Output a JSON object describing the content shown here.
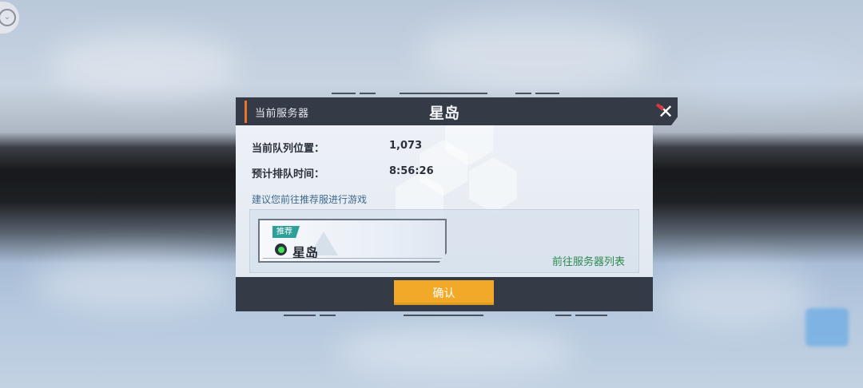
{
  "dialog": {
    "header_label": "当前服务器",
    "title": "星岛",
    "queue_position_label": "当前队列位置：",
    "queue_position_value": "1,073",
    "estimated_wait_label": "预计排队时间：",
    "estimated_wait_value": "8:56:26",
    "suggestion": "建议您前往推荐服进行游戏",
    "recommended_badge": "推荐",
    "recommended_server": "星岛",
    "server_status": "online",
    "goto_server_list": "前往服务器列表",
    "confirm": "确认"
  },
  "icons": {
    "close": "close-x-icon",
    "back": "back-chevron-icon",
    "status": "green-status-dot-icon"
  },
  "colors": {
    "panel_dark": "#343a46",
    "accent_orange": "#e9772b",
    "confirm_button": "#f2a928",
    "badge_teal": "#2f9f9a",
    "link_green": "#2f8a4f",
    "status_green": "#3fe05a",
    "close_red": "#d9363e"
  }
}
